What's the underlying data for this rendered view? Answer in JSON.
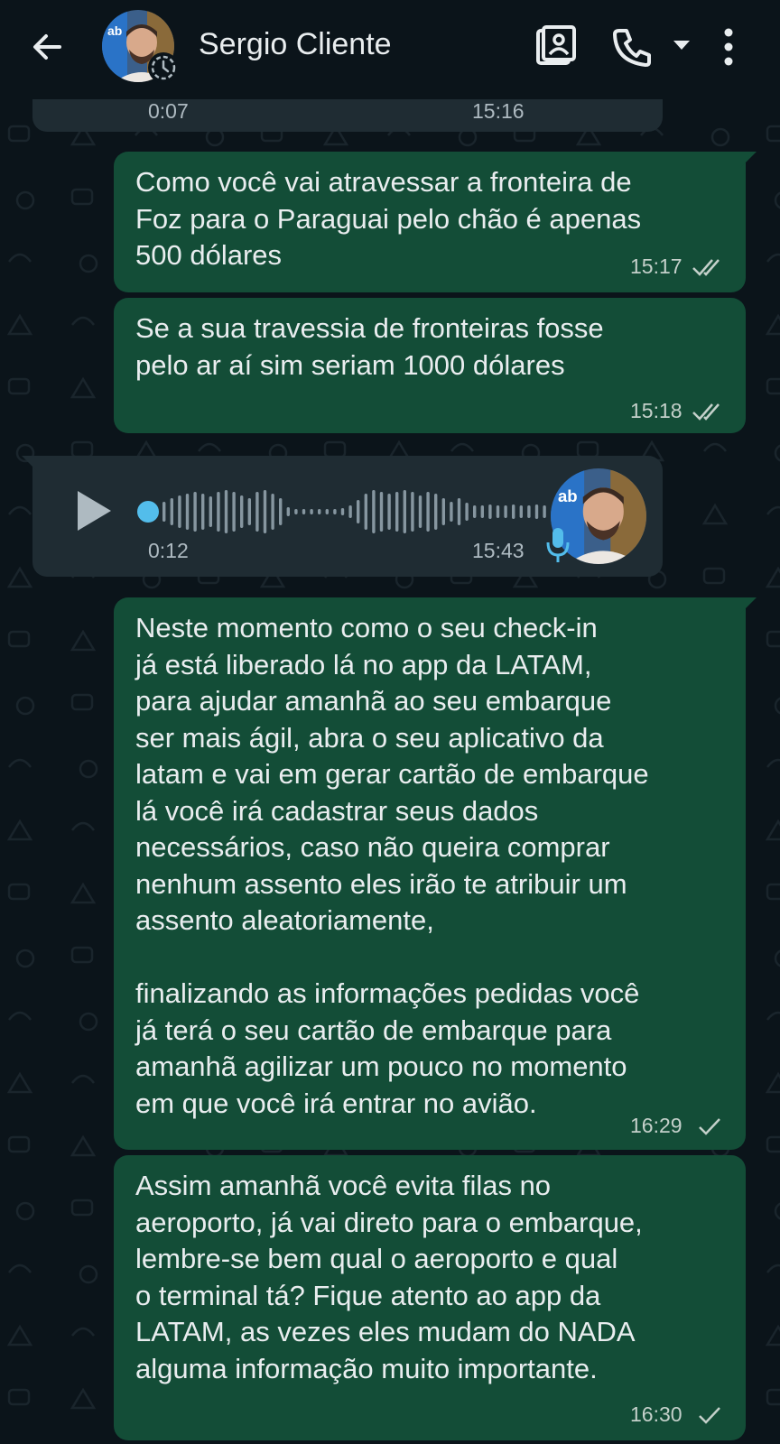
{
  "header": {
    "back_icon": "arrow-left-icon",
    "contact_name": "Sergio Cliente",
    "avatar_badge_text": "ab",
    "video_icon": "video-call-icon",
    "call_icon": "phone-icon",
    "more_icon": "more-vert-icon"
  },
  "colors": {
    "background": "#0b141a",
    "outgoing_bubble": "#134d37",
    "incoming_bubble": "#1f2c33",
    "voice_dot": "#53bdeb",
    "mic": "#53bdeb"
  },
  "messages": [
    {
      "type": "voice",
      "direction": "incoming",
      "duration": "0:07",
      "time": "15:16",
      "partially_visible": true
    },
    {
      "type": "text",
      "direction": "outgoing",
      "text": "Como você vai atravessar a fronteira de\nFoz para o Paraguai pelo chão é apenas\n500 dólares",
      "time": "15:17",
      "status": "read-ticks"
    },
    {
      "type": "text",
      "direction": "outgoing",
      "text": "Se a sua travessia de fronteiras fosse\npelo ar aí sim seriam 1000 dólares",
      "time": "15:18",
      "status": "read-ticks"
    },
    {
      "type": "voice",
      "direction": "incoming",
      "duration": "0:12",
      "time": "15:43",
      "play_icon": "play-icon",
      "mic_icon": "mic-icon"
    },
    {
      "type": "text",
      "direction": "outgoing",
      "text": "Neste momento como o seu check-in\njá está liberado lá no app da LATAM,\npara ajudar amanhã ao seu embarque\nser mais ágil, abra o seu aplicativo da\nlatam e vai em gerar cartão de embarque\nlá você irá cadastrar seus dados\nnecessários, caso não queira comprar\nnenhum assento eles irão te atribuir um\nassento aleatoriamente,\n\nfinalizando as informações pedidas você\njá terá o seu cartão de embarque para\namanhã agilizar um pouco no momento\nem que você irá entrar no avião.",
      "time": "16:29",
      "status": "sent-tick"
    },
    {
      "type": "text",
      "direction": "outgoing",
      "text": "Assim amanhã você evita filas no\naeroporto, já vai direto para o embarque,\nlembre-se bem qual o aeroporto e qual\no terminal tá? Fique atento ao app da\nLATAM, as vezes eles mudam do NADA\nalguma informação muito importante.",
      "time": "16:30",
      "status": "sent-tick"
    }
  ]
}
